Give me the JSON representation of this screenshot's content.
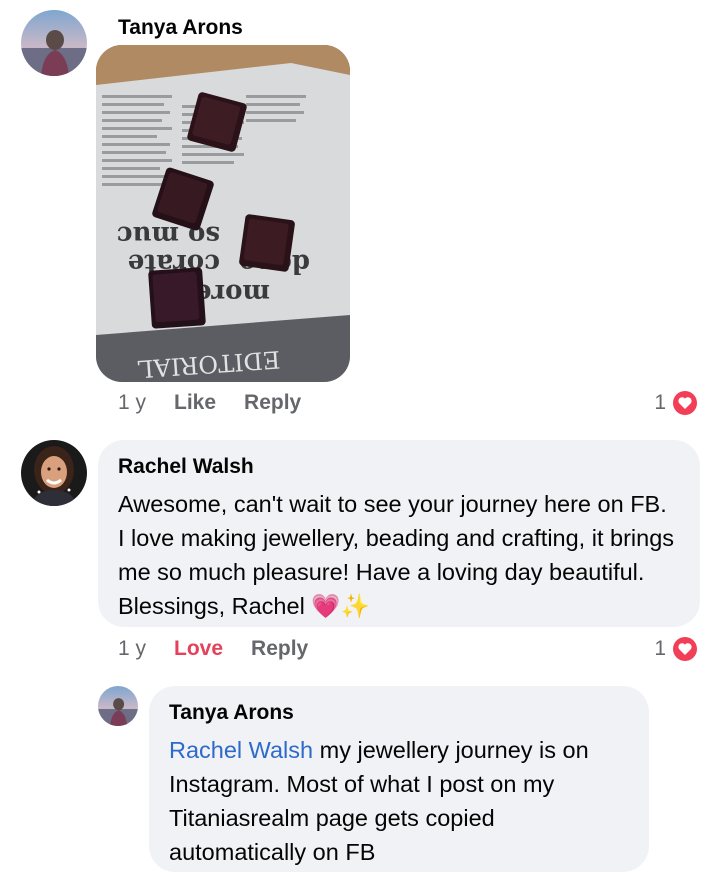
{
  "comments": [
    {
      "author": "Tanya Arons",
      "avatar_icon": "profile-photo-beach-icon",
      "image_alt": "jewellery pieces on newspaper",
      "newspaper_text": [
        "EDITORIAL",
        "more",
        "done",
        "so muc",
        "corate"
      ],
      "time": "1 y",
      "actions": [
        "Like",
        "Reply"
      ],
      "reaction_count": "1",
      "reaction_icon": "love-reaction-icon"
    },
    {
      "author": "Rachel Walsh",
      "avatar_icon": "profile-photo-woman-icon",
      "text": "Awesome, can't wait to see your journey here on FB. I love making jewellery, beading and crafting, it brings me so much pleasure! Have a loving day beautiful. Blessings, Rachel",
      "emojis": [
        "💗",
        "✨"
      ],
      "time": "1 y",
      "actions": [
        "Love",
        "Reply"
      ],
      "reaction_count": "1",
      "reaction_icon": "love-reaction-icon"
    },
    {
      "author": "Tanya Arons",
      "avatar_icon": "profile-photo-beach-icon",
      "mention": "Rachel Walsh",
      "text": "my jewellery journey is on Instagram.  Most of what I post on my Titaniasrealm page gets copied automatically on FB"
    }
  ],
  "colors": {
    "bubble": "#f0f2f5",
    "secondary_text": "#65676b",
    "love": "#e4415b",
    "mention": "#2d6ac9"
  }
}
